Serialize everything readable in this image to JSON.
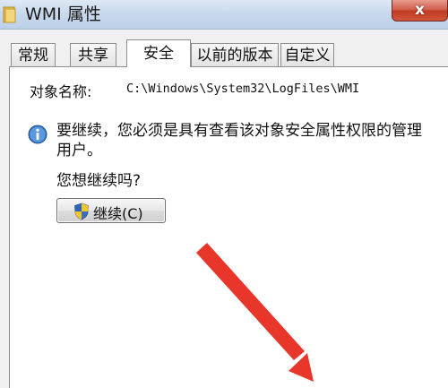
{
  "window": {
    "title": "WMI 属性",
    "close_glyph": "x"
  },
  "tabs": [
    {
      "label": "常规",
      "active": false
    },
    {
      "label": "共享",
      "active": false
    },
    {
      "label": "安全",
      "active": true
    },
    {
      "label": "以前的版本",
      "active": false
    },
    {
      "label": "自定义",
      "active": false
    }
  ],
  "security": {
    "object_name_label": "对象名称:",
    "object_name_value": "C:\\Windows\\System32\\LogFiles\\WMI",
    "permission_message": "要继续，您必须是具有查看该对象安全属性权限的管理用户。",
    "question": "您想继续吗?",
    "continue_button": "继续(C)"
  },
  "icons": {
    "title": "folder-icon",
    "info": "info-icon",
    "button": "uac-shield-icon"
  },
  "colors": {
    "annotation_arrow": "#e8362b"
  }
}
